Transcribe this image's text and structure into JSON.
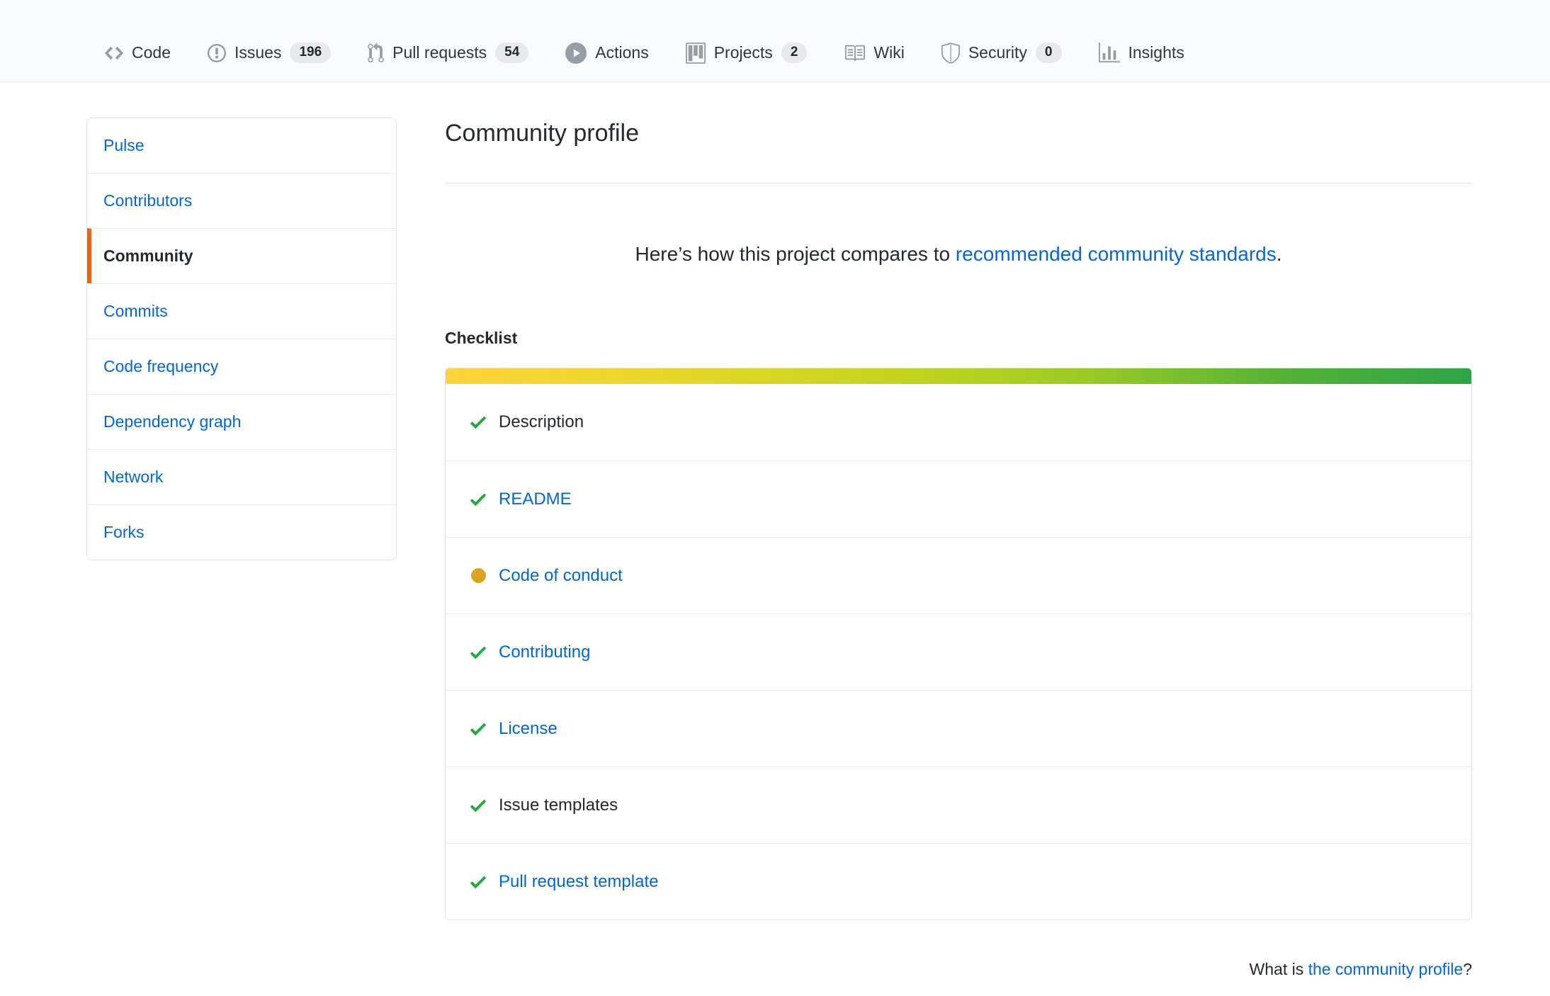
{
  "nav": {
    "items": [
      {
        "label": "Code",
        "icon": "code-icon"
      },
      {
        "label": "Issues",
        "badge": "196",
        "icon": "issue-opened-icon"
      },
      {
        "label": "Pull requests",
        "badge": "54",
        "icon": "git-pull-request-icon"
      },
      {
        "label": "Actions",
        "icon": "play-icon"
      },
      {
        "label": "Projects",
        "badge": "2",
        "icon": "project-icon"
      },
      {
        "label": "Wiki",
        "icon": "book-icon"
      },
      {
        "label": "Security",
        "badge": "0",
        "icon": "shield-icon"
      },
      {
        "label": "Insights",
        "icon": "graph-icon"
      }
    ]
  },
  "sidebar": {
    "items": [
      {
        "label": "Pulse",
        "selected": false
      },
      {
        "label": "Contributors",
        "selected": false
      },
      {
        "label": "Community",
        "selected": true
      },
      {
        "label": "Commits",
        "selected": false
      },
      {
        "label": "Code frequency",
        "selected": false
      },
      {
        "label": "Dependency graph",
        "selected": false
      },
      {
        "label": "Network",
        "selected": false
      },
      {
        "label": "Forks",
        "selected": false
      }
    ]
  },
  "main": {
    "title": "Community profile",
    "intro": {
      "prefix": "Here’s how this project compares to ",
      "link": "recommended community standards",
      "suffix": "."
    },
    "checklist_title": "Checklist",
    "checklist": {
      "items": [
        {
          "label": "Description",
          "status": "complete",
          "is_link": false
        },
        {
          "label": "README",
          "status": "complete",
          "is_link": true
        },
        {
          "label": "Code of conduct",
          "status": "pending",
          "is_link": true
        },
        {
          "label": "Contributing",
          "status": "complete",
          "is_link": true
        },
        {
          "label": "License",
          "status": "complete",
          "is_link": true
        },
        {
          "label": "Issue templates",
          "status": "complete",
          "is_link": false
        },
        {
          "label": "Pull request template",
          "status": "complete",
          "is_link": true
        }
      ]
    },
    "footer": {
      "prefix": "What is ",
      "link": "the community profile",
      "suffix": "?"
    }
  },
  "colors": {
    "link_blue": "#0366d6",
    "selected_marker_orange": "#e8650e",
    "complete_check_green": "#28a745",
    "pending_dot_yellow": "#d9a521",
    "progress_gradient_start": "#fcd33d",
    "progress_gradient_end": "#2ea44a",
    "nav_background": "#fafbfc",
    "border_gray": "#e1e4e8"
  }
}
